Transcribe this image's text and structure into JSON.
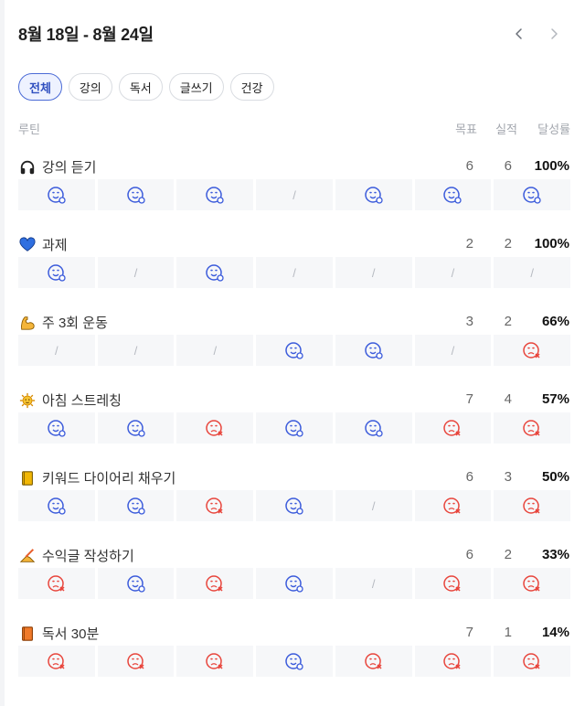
{
  "header": {
    "title": "8월 18일 - 8월 24일"
  },
  "tabs": [
    "전체",
    "강의",
    "독서",
    "글쓰기",
    "건강"
  ],
  "active_tab": 0,
  "columns": {
    "routine": "루틴",
    "goal": "목표",
    "done": "실적",
    "rate": "달성률"
  },
  "colors": {
    "success": "#3b5bdb",
    "fail": "#e8453c",
    "accent": "#4b6bd6"
  },
  "routines": [
    {
      "icon": "headphones-icon",
      "name": "강의 듣기",
      "goal": "6",
      "done": "6",
      "rate": "100%",
      "days": [
        "success",
        "success",
        "success",
        "none",
        "success",
        "success",
        "success"
      ]
    },
    {
      "icon": "blue-heart-icon",
      "name": "과제",
      "goal": "2",
      "done": "2",
      "rate": "100%",
      "days": [
        "success",
        "none",
        "success",
        "none",
        "none",
        "none",
        "none"
      ]
    },
    {
      "icon": "flexed-biceps-icon",
      "name": "주 3회 운동",
      "goal": "3",
      "done": "2",
      "rate": "66%",
      "days": [
        "none",
        "none",
        "none",
        "success",
        "success",
        "none",
        "fail"
      ]
    },
    {
      "icon": "sun-icon",
      "name": "아침 스트레칭",
      "goal": "7",
      "done": "4",
      "rate": "57%",
      "days": [
        "success",
        "success",
        "fail",
        "success",
        "success",
        "fail",
        "fail"
      ]
    },
    {
      "icon": "yellow-notebook-icon",
      "name": "키워드 다이어리 채우기",
      "goal": "6",
      "done": "3",
      "rate": "50%",
      "days": [
        "success",
        "success",
        "fail",
        "success",
        "none",
        "fail",
        "fail"
      ]
    },
    {
      "icon": "writing-hand-icon",
      "name": "수익글 작성하기",
      "goal": "6",
      "done": "2",
      "rate": "33%",
      "days": [
        "fail",
        "success",
        "fail",
        "success",
        "none",
        "fail",
        "fail"
      ]
    },
    {
      "icon": "orange-book-icon",
      "name": "독서 30분",
      "goal": "7",
      "done": "1",
      "rate": "14%",
      "days": [
        "fail",
        "fail",
        "fail",
        "success",
        "fail",
        "fail",
        "fail"
      ]
    }
  ],
  "none_mark": "/"
}
